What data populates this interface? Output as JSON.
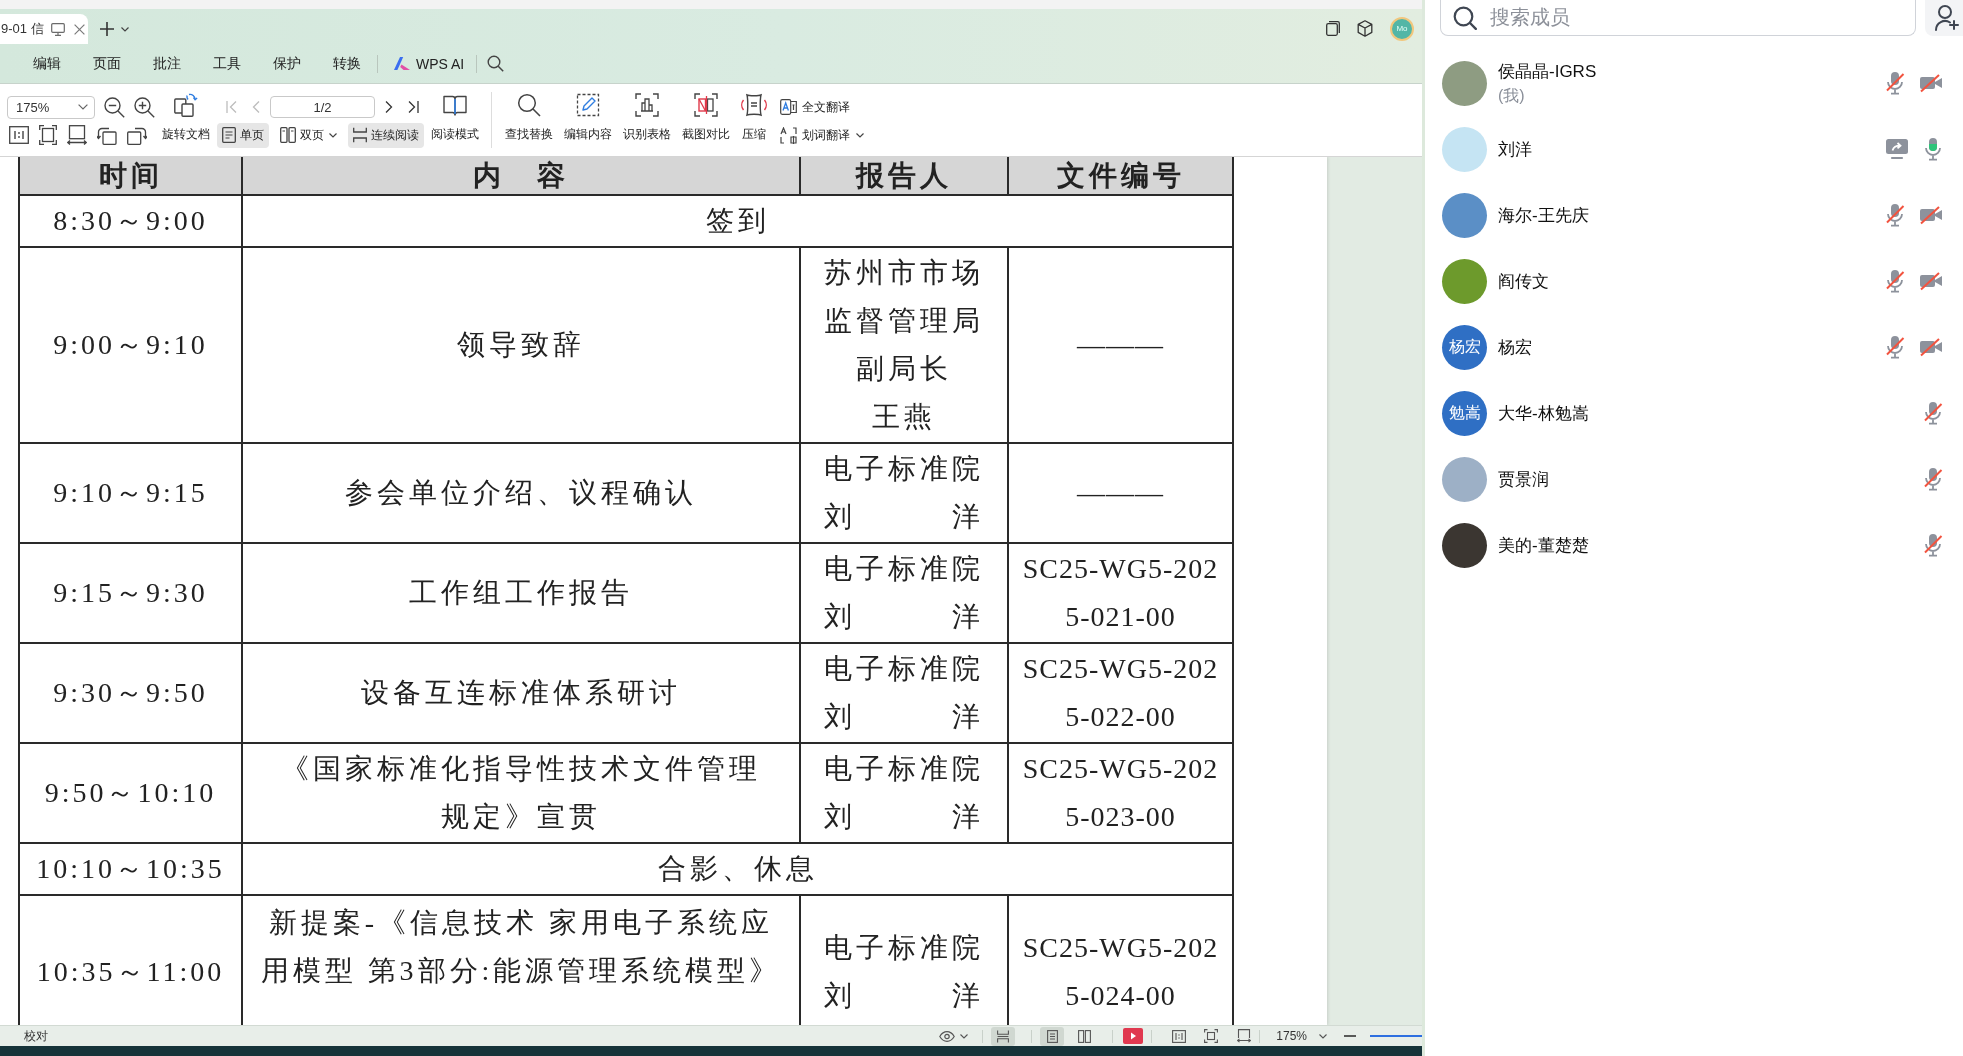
{
  "tab_bar": {
    "tab_title": "9-01 信",
    "account_initials": "Mo"
  },
  "menu": {
    "items": [
      "编辑",
      "页面",
      "批注",
      "工具",
      "保护",
      "转换"
    ],
    "ai_label": "WPS AI"
  },
  "toolbar": {
    "zoom": "175%",
    "page": "1/2",
    "page_nav": [
      {
        "disabled": true
      },
      {
        "disabled": true
      },
      {
        "disabled": false
      },
      {
        "disabled": false
      }
    ],
    "rotate_label": "旋转文档",
    "view_buttons": [
      {
        "label": "单页",
        "selected": true,
        "dropdown": false
      },
      {
        "label": "双页",
        "selected": false,
        "dropdown": true
      },
      {
        "label": "连续阅读",
        "selected": true,
        "dropdown": false
      }
    ],
    "read_mode_label": "阅读模式",
    "tools": [
      "查找替换",
      "编辑内容",
      "识别表格",
      "截图对比",
      "压缩"
    ],
    "translate": [
      {
        "label": "全文翻译",
        "dropdown": false
      },
      {
        "label": "划词翻译",
        "dropdown": true
      }
    ]
  },
  "document": {
    "columns": [
      "时间",
      "内　容",
      "报告人",
      "文件编号"
    ],
    "rows": [
      {
        "kind": "merged",
        "time": "8:30～9:00",
        "text": "签到"
      },
      {
        "kind": "item",
        "time": "9:00～9:10",
        "content": [
          "领导致辞"
        ],
        "reporter": [
          "苏州市市场",
          "监督管理局",
          "副局长",
          "王燕"
        ],
        "file": [
          "———"
        ]
      },
      {
        "kind": "item",
        "time": "9:10～9:15",
        "content": [
          "参会单位介绍、议程确认"
        ],
        "reporter": [
          "电子标准院",
          "刘　　　洋"
        ],
        "file": [
          "———"
        ]
      },
      {
        "kind": "item",
        "time": "9:15～9:30",
        "content": [
          "工作组工作报告"
        ],
        "reporter": [
          "电子标准院",
          "刘　　　洋"
        ],
        "file": [
          "SC25-WG5-202",
          "5-021-00"
        ]
      },
      {
        "kind": "item",
        "time": "9:30～9:50",
        "content": [
          "设备互连标准体系研讨"
        ],
        "reporter": [
          "电子标准院",
          "刘　　　洋"
        ],
        "file": [
          "SC25-WG5-202",
          "5-022-00"
        ]
      },
      {
        "kind": "item",
        "time": "9:50～10:10",
        "content": [
          "《国家标准化指导性技术文件管理",
          "规定》宣贯"
        ],
        "reporter": [
          "电子标准院",
          "刘　　　洋"
        ],
        "file": [
          "SC25-WG5-202",
          "5-023-00"
        ]
      },
      {
        "kind": "merged",
        "time": "10:10～10:35",
        "text": "合影、休息"
      },
      {
        "kind": "item",
        "time": "10:35～11:00",
        "content": [
          "新提案-《信息技术 家用电子系统应",
          "用模型 第3部分:能源管理系统模型》"
        ],
        "reporter": [
          "电子标准院",
          "刘　　　洋"
        ],
        "file": [
          "SC25-WG5-202",
          "5-024-00"
        ]
      }
    ]
  },
  "status_bar": {
    "label": "校对",
    "view_modes": [
      {
        "selected": true
      },
      {
        "selected": true
      },
      {
        "selected": false
      }
    ],
    "zoom": "175%",
    "zoom_slider": {
      "level": 1
    }
  },
  "members_panel": {
    "search": {
      "placeholder": "搜索成员"
    },
    "members": [
      {
        "name": "侯晶晶-IGRS",
        "note": "(我)",
        "avatar": {
          "kind": "photo",
          "color": "#8e9c82"
        },
        "icons": [
          {
            "kind": "mic",
            "on": false
          },
          {
            "kind": "camera",
            "on": false
          }
        ]
      },
      {
        "name": "刘洋",
        "avatar": {
          "kind": "photo",
          "color": "#c5e4f3"
        },
        "icons": [
          {
            "kind": "share"
          },
          {
            "kind": "mic",
            "on": true
          }
        ]
      },
      {
        "name": "海尔-王先庆",
        "avatar": {
          "kind": "photo",
          "color": "#5b8fc6"
        },
        "icons": [
          {
            "kind": "mic",
            "on": false
          },
          {
            "kind": "camera",
            "on": false
          }
        ]
      },
      {
        "name": "阎传文",
        "avatar": {
          "kind": "photo",
          "color": "#6d9a2c"
        },
        "icons": [
          {
            "kind": "mic",
            "on": false
          },
          {
            "kind": "camera",
            "on": false
          }
        ]
      },
      {
        "name": "杨宏",
        "avatar": {
          "kind": "initials",
          "text": "杨宏",
          "color": "#2f6fc4"
        },
        "icons": [
          {
            "kind": "mic",
            "on": false
          },
          {
            "kind": "camera",
            "on": false
          }
        ]
      },
      {
        "name": "大华-林勉嵩",
        "avatar": {
          "kind": "initials",
          "text": "勉嵩",
          "color": "#2f6fc4"
        },
        "icons": [
          {
            "kind": "mic",
            "on": false
          }
        ]
      },
      {
        "name": "贾景润",
        "avatar": {
          "kind": "photo",
          "color": "#9db0c6"
        },
        "icons": [
          {
            "kind": "mic",
            "on": false
          }
        ]
      },
      {
        "name": "美的-董楚楚",
        "avatar": {
          "kind": "photo",
          "color": "#3b3631"
        },
        "icons": [
          {
            "kind": "mic",
            "on": false
          }
        ]
      }
    ]
  }
}
